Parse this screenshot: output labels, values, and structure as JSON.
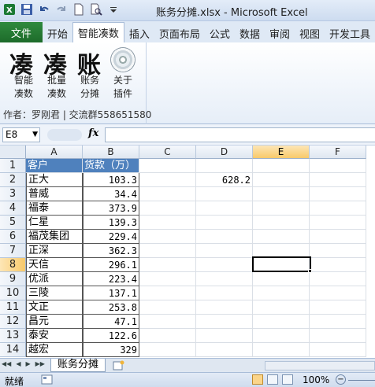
{
  "window": {
    "title": "账务分摊.xlsx  -  Microsoft Excel"
  },
  "ribbon": {
    "file_tab": "文件",
    "tabs": [
      "开始",
      "智能凑数",
      "插入",
      "页面布局",
      "公式",
      "数据",
      "审阅",
      "视图",
      "开发工具"
    ],
    "active_tab": "智能凑数",
    "logo_chars": [
      "凑",
      "凑",
      "账"
    ],
    "buttons": [
      {
        "line1": "智能",
        "line2": "凑数"
      },
      {
        "line1": "批量",
        "line2": "凑数"
      },
      {
        "line1": "账务",
        "line2": "分摊"
      },
      {
        "line1": "关于",
        "line2": "插件"
      }
    ],
    "author": "作者：罗刚君 | 交流群558651580"
  },
  "formula_bar": {
    "name_box": "E8",
    "fx": "fx",
    "formula": ""
  },
  "grid": {
    "columns": [
      "A",
      "B",
      "C",
      "D",
      "E",
      "F"
    ],
    "selected_column": "E",
    "selected_row": "8",
    "rows": [
      {
        "n": "1",
        "a": "客户",
        "b": "货款（万）",
        "d": ""
      },
      {
        "n": "2",
        "a": "正大",
        "b": "103.3",
        "d": "628.2"
      },
      {
        "n": "3",
        "a": "普威",
        "b": "34.4",
        "d": ""
      },
      {
        "n": "4",
        "a": "福泰",
        "b": "373.9",
        "d": ""
      },
      {
        "n": "5",
        "a": "仁星",
        "b": "139.3",
        "d": ""
      },
      {
        "n": "6",
        "a": "福茂集团",
        "b": "229.4",
        "d": ""
      },
      {
        "n": "7",
        "a": "正深",
        "b": "362.3",
        "d": ""
      },
      {
        "n": "8",
        "a": "天信",
        "b": "296.1",
        "d": ""
      },
      {
        "n": "9",
        "a": "优派",
        "b": "223.4",
        "d": ""
      },
      {
        "n": "10",
        "a": "三陵",
        "b": "137.1",
        "d": ""
      },
      {
        "n": "11",
        "a": "文正",
        "b": "253.8",
        "d": ""
      },
      {
        "n": "12",
        "a": "昌元",
        "b": "47.1",
        "d": ""
      },
      {
        "n": "13",
        "a": "泰安",
        "b": "122.6",
        "d": ""
      },
      {
        "n": "14",
        "a": "越宏",
        "b": "329",
        "d": ""
      }
    ]
  },
  "sheets": {
    "tabs": [
      "账务分摊"
    ]
  },
  "status": {
    "mode": "就绪",
    "zoom": "100%"
  }
}
